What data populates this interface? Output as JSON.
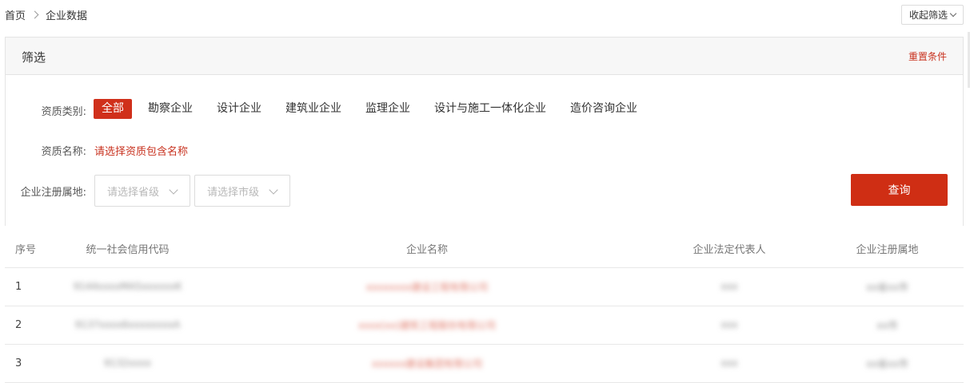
{
  "breadcrumb": {
    "home": "首页",
    "current": "企业数据"
  },
  "collapse_button": "收起筛选",
  "filter": {
    "title": "筛选",
    "reset": "重置条件",
    "qualification_type_label": "资质类别:",
    "qualification_types": [
      {
        "label": "全部",
        "active": true
      },
      {
        "label": "勘察企业",
        "active": false
      },
      {
        "label": "设计企业",
        "active": false
      },
      {
        "label": "建筑业企业",
        "active": false
      },
      {
        "label": "监理企业",
        "active": false
      },
      {
        "label": "设计与施工一体化企业",
        "active": false
      },
      {
        "label": "造价咨询企业",
        "active": false
      }
    ],
    "qualification_name_label": "资质名称:",
    "qualification_name_placeholder": "请选择资质包含名称",
    "location_label": "企业注册属地:",
    "province_placeholder": "请选择省级",
    "city_placeholder": "请选择市级",
    "query_button": "查询"
  },
  "table": {
    "headers": {
      "index": "序号",
      "credit_code": "统一社会信用代码",
      "company_name": "企业名称",
      "legal_rep": "企业法定代表人",
      "location": "企业注册属地"
    },
    "rows": [
      {
        "index": "1",
        "credit_code": "9144xxxxMA5xxxxxxK",
        "company_name": "xxxxxxxx建设工程有限公司",
        "legal_rep": "xxx",
        "location": "xx省xx市"
      },
      {
        "index": "2",
        "credit_code": "9137xxxx6xxxxxxxxA",
        "company_name": "xxxx(xx)建筑工程股份有限公司",
        "legal_rep": "xxx",
        "location": "xx市"
      },
      {
        "index": "3",
        "credit_code": "9132xxxx",
        "company_name": "xxxxxx建设集团有限公司",
        "legal_rep": "xxx",
        "location": "xx省xx市"
      }
    ]
  },
  "colors": {
    "accent": "#cf2e14",
    "link": "#c8321f"
  }
}
